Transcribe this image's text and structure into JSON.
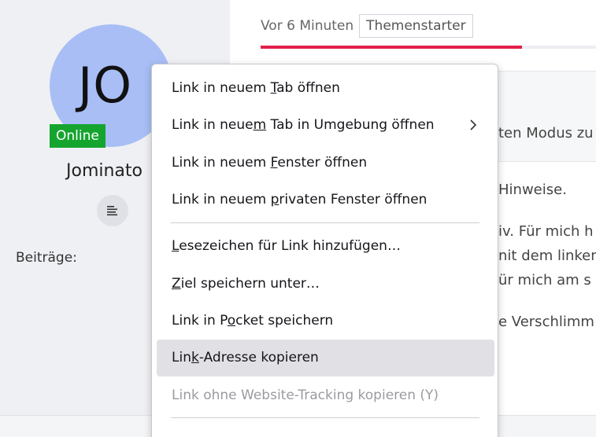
{
  "profile": {
    "initials": "JO",
    "online_label": "Online",
    "username": "Jominato",
    "posts_label": "Beiträge:",
    "menu_icon": "list-lines-icon"
  },
  "post": {
    "time_label": "Vor 6 Minuten",
    "starter_badge": "Themenstarter",
    "accent_color": "#e3204a",
    "reading_progress": 0.78,
    "box_text": "ten Modus zu",
    "lines": [
      "Hinweise.",
      "iv. Für mich h",
      "nit dem linken",
      "ür mich am s",
      "e Verschlimm"
    ]
  },
  "context_menu": {
    "items": [
      {
        "pre": "Link in neuem ",
        "key": "T",
        "post": "ab öffnen"
      },
      {
        "pre": "Link in neue",
        "key": "m",
        "post": " Tab in Umgebung öffnen",
        "submenu_icon": "chevron-right-icon"
      },
      {
        "pre": "Link in neuem ",
        "key": "F",
        "post": "enster öffnen"
      },
      {
        "pre": "Link in neuem ",
        "key": "p",
        "post": "rivaten Fenster öffnen"
      },
      {
        "pre": "",
        "key": "L",
        "post": "esezeichen für Link hinzufügen…"
      },
      {
        "pre": "",
        "key": "Z",
        "post": "iel speichern unter…"
      },
      {
        "pre": "Link in P",
        "key": "o",
        "post": "cket speichern"
      },
      {
        "pre": "Lin",
        "key": "k",
        "post": "-Adresse kopieren"
      },
      {
        "pre": "Link ohne Website-Tracking kopieren (Y)",
        "key": "",
        "post": ""
      }
    ],
    "highlighted_index": 7,
    "disabled_index": 8
  }
}
